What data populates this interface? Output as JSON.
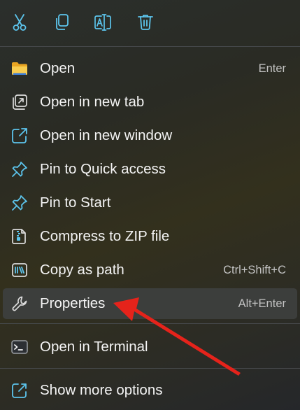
{
  "toolbar": {
    "buttons": [
      {
        "icon": "cut-icon"
      },
      {
        "icon": "copy-icon"
      },
      {
        "icon": "rename-icon"
      },
      {
        "icon": "delete-icon"
      }
    ]
  },
  "items": [
    {
      "label": "Open",
      "shortcut": "Enter",
      "icon": "folder-icon"
    },
    {
      "label": "Open in new tab",
      "shortcut": "",
      "icon": "new-tab-icon"
    },
    {
      "label": "Open in new window",
      "shortcut": "",
      "icon": "new-window-icon"
    },
    {
      "label": "Pin to Quick access",
      "shortcut": "",
      "icon": "pin-icon"
    },
    {
      "label": "Pin to Start",
      "shortcut": "",
      "icon": "pin-icon"
    },
    {
      "label": "Compress to ZIP file",
      "shortcut": "",
      "icon": "zip-icon"
    },
    {
      "label": "Copy as path",
      "shortcut": "Ctrl+Shift+C",
      "icon": "copy-path-icon"
    },
    {
      "label": "Properties",
      "shortcut": "Alt+Enter",
      "icon": "wrench-icon"
    },
    {
      "label": "Open in Terminal",
      "shortcut": "",
      "icon": "terminal-icon"
    },
    {
      "label": "Show more options",
      "shortcut": "",
      "icon": "show-more-icon"
    }
  ],
  "colors": {
    "accent": "#4fc3f7",
    "folder": "#f5c342",
    "arrow": "#e5231b"
  }
}
